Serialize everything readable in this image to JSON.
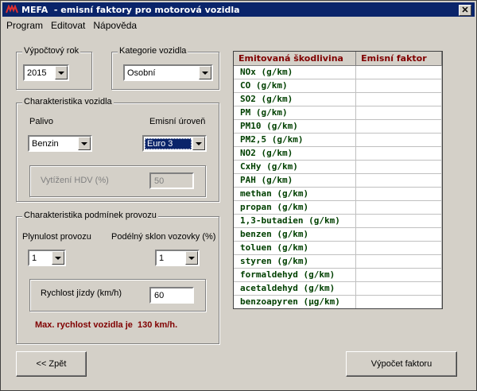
{
  "window": {
    "title": "MEFA  - emisní faktory pro motorová vozidla"
  },
  "menu": [
    {
      "label": "Program"
    },
    {
      "label": "Editovat"
    },
    {
      "label": "Nápověda"
    }
  ],
  "year_group": {
    "legend": "Výpočtový rok",
    "value": "2015"
  },
  "category_group": {
    "legend": "Kategorie vozidla",
    "value": "Osobní"
  },
  "vehicle_group": {
    "legend": "Charakteristika vozidla",
    "fuel_label": "Palivo",
    "fuel_value": "Benzin",
    "emission_label": "Emisní úroveň",
    "emission_value": "Euro 3",
    "hdv_label": "Vytížení HDV (%)",
    "hdv_value": "50"
  },
  "conditions_group": {
    "legend": "Charakteristika podmínek provozu",
    "flow_label": "Plynulost provozu",
    "flow_value": "1",
    "slope_label": "Podélný sklon vozovky (%)",
    "slope_value": "1",
    "speed_label": "Rychlost jízdy (km/h)",
    "speed_value": "60",
    "max_speed_text": "Max. rychlost vozidla je  130 km/h."
  },
  "table": {
    "columns": [
      "Emitovaná škodlivina",
      "Emisní faktor"
    ],
    "rows": [
      "NOx (g/km)",
      "CO (g/km)",
      "SO2 (g/km)",
      "PM (g/km)",
      "PM10 (g/km)",
      "PM2,5 (g/km)",
      "NO2 (g/km)",
      "CxHy (g/km)",
      "PAH (g/km)",
      "methan (g/km)",
      "propan (g/km)",
      "1,3-butadien (g/km)",
      "benzen (g/km)",
      "toluen (g/km)",
      "styren (g/km)",
      "formaldehyd (g/km)",
      "acetaldehyd (g/km)",
      "benzoapyren (µg/km)"
    ]
  },
  "buttons": {
    "back": "<< Zpět",
    "compute": "Výpočet faktoru"
  },
  "colors": {
    "title_bg": "#0a246a",
    "header_text": "#800000",
    "row_text": "#004000",
    "face": "#d4d0c8"
  }
}
